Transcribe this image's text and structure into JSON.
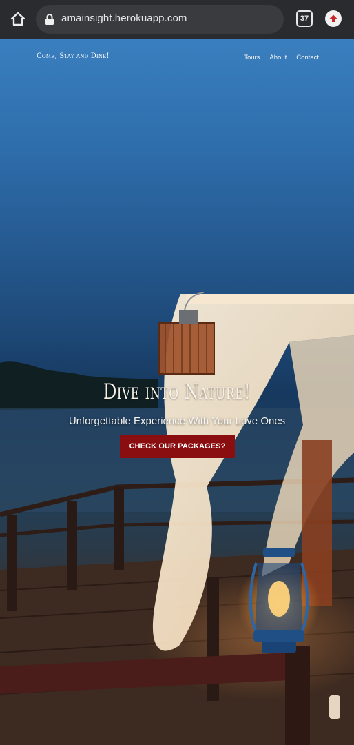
{
  "browser": {
    "url": "amainsight.herokuapp.com",
    "tab_count": "37",
    "icons": {
      "home": "home-icon",
      "lock": "lock-icon",
      "tabs": "tabs-icon",
      "update": "update-arrow-icon"
    }
  },
  "site": {
    "brand": "Come, Stay and Dine!",
    "nav": [
      {
        "label": "Tours"
      },
      {
        "label": "About"
      },
      {
        "label": "Contact"
      }
    ]
  },
  "hero": {
    "title": "Dive into Nature!",
    "subtitle": "Unforgettable Experience With Your Love Ones",
    "cta_label": "CHECK OUR PACKAGES?"
  },
  "colors": {
    "chrome_bg": "#2a2b2e",
    "urlbar_bg": "#3a3b3f",
    "cta_bg": "#8a0d0f",
    "sky_top": "#3a7fbf"
  }
}
